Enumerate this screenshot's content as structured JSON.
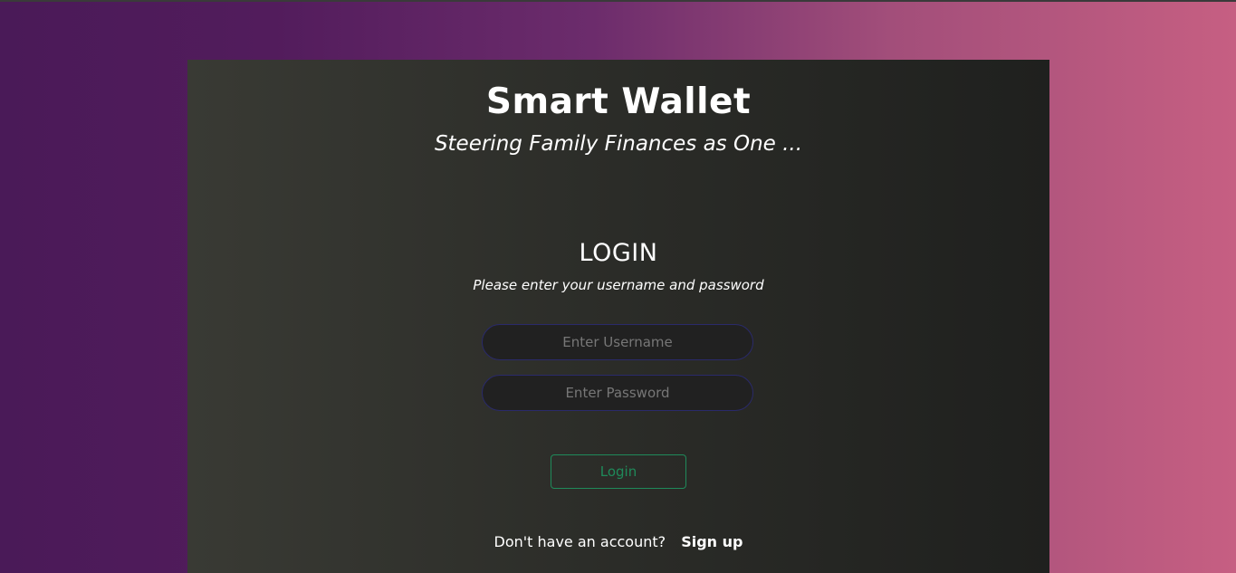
{
  "app": {
    "title": "Smart Wallet",
    "tagline": "Steering Family Finances as One ..."
  },
  "login": {
    "heading": "LOGIN",
    "instructions": "Please enter your username and password",
    "username": {
      "placeholder": "Enter Username",
      "value": ""
    },
    "password": {
      "placeholder": "Enter Password",
      "value": ""
    },
    "submit_label": "Login"
  },
  "signup": {
    "prompt": "Don't have an account?",
    "link_label": "Sign up"
  },
  "colors": {
    "background_start": "#4a1a58",
    "background_end": "#c65f82",
    "card": "#2b2c28",
    "input_border": "#2a2a6a",
    "login_button": "#1f8a5a",
    "text": "#ffffff"
  }
}
